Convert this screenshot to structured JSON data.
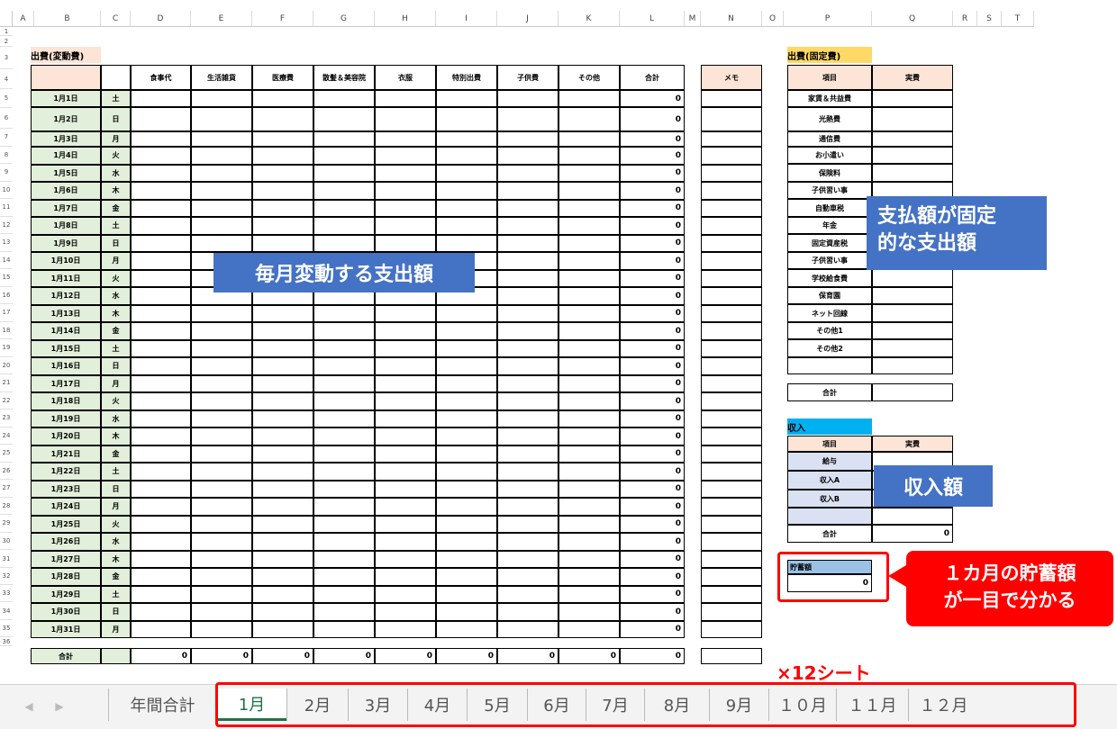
{
  "columns": [
    "A",
    "B",
    "C",
    "D",
    "E",
    "F",
    "G",
    "H",
    "I",
    "J",
    "K",
    "L",
    "M",
    "N",
    "O",
    "P",
    "Q",
    "R",
    "S",
    "T"
  ],
  "rows": [
    "1",
    "2",
    "3",
    "4",
    "5",
    "6",
    "7",
    "8",
    "9",
    "10",
    "11",
    "12",
    "13",
    "14",
    "15",
    "16",
    "17",
    "18",
    "19",
    "20",
    "21",
    "22",
    "23",
    "24",
    "25",
    "26",
    "27",
    "28",
    "29",
    "30",
    "31",
    "32",
    "33",
    "34",
    "35",
    "36"
  ],
  "variable": {
    "title": "出費(変動費)",
    "headers": [
      "食事代",
      "生活雑貨",
      "医療費",
      "散髪＆美容院",
      "衣服",
      "特別出費",
      "子供費",
      "その他",
      "合計"
    ],
    "days": [
      {
        "date": "1月1日",
        "dow": "土"
      },
      {
        "date": "1月2日",
        "dow": "日"
      },
      {
        "date": "1月3日",
        "dow": "月"
      },
      {
        "date": "1月4日",
        "dow": "火"
      },
      {
        "date": "1月5日",
        "dow": "水"
      },
      {
        "date": "1月6日",
        "dow": "木"
      },
      {
        "date": "1月7日",
        "dow": "金"
      },
      {
        "date": "1月8日",
        "dow": "土"
      },
      {
        "date": "1月9日",
        "dow": "日"
      },
      {
        "date": "1月10日",
        "dow": "月"
      },
      {
        "date": "1月11日",
        "dow": "火"
      },
      {
        "date": "1月12日",
        "dow": "水"
      },
      {
        "date": "1月13日",
        "dow": "木"
      },
      {
        "date": "1月14日",
        "dow": "金"
      },
      {
        "date": "1月15日",
        "dow": "土"
      },
      {
        "date": "1月16日",
        "dow": "日"
      },
      {
        "date": "1月17日",
        "dow": "月"
      },
      {
        "date": "1月18日",
        "dow": "火"
      },
      {
        "date": "1月19日",
        "dow": "水"
      },
      {
        "date": "1月20日",
        "dow": "木"
      },
      {
        "date": "1月21日",
        "dow": "金"
      },
      {
        "date": "1月22日",
        "dow": "土"
      },
      {
        "date": "1月23日",
        "dow": "日"
      },
      {
        "date": "1月24日",
        "dow": "月"
      },
      {
        "date": "1月25日",
        "dow": "火"
      },
      {
        "date": "1月26日",
        "dow": "水"
      },
      {
        "date": "1月27日",
        "dow": "木"
      },
      {
        "date": "1月28日",
        "dow": "金"
      },
      {
        "date": "1月29日",
        "dow": "土"
      },
      {
        "date": "1月30日",
        "dow": "日"
      },
      {
        "date": "1月31日",
        "dow": "月"
      }
    ],
    "row_total": "0",
    "total_label": "合計",
    "footer_values": [
      "0",
      "0",
      "0",
      "0",
      "0",
      "0",
      "0",
      "0",
      "0"
    ]
  },
  "memo": {
    "header": "メモ"
  },
  "fixed": {
    "title": "出費(固定費)",
    "header_item": "項目",
    "header_amount": "実費",
    "items": [
      "家賃＆共益費",
      "光熱費",
      "通信費",
      "お小遣い",
      "保険料",
      "子供習い事",
      "自動車税",
      "年金",
      "固定資産税",
      "子供習い事",
      "学校給食費",
      "保育園",
      "ネット回線",
      "その他1",
      "その他2",
      ""
    ],
    "total_label": "合計"
  },
  "income": {
    "title": "収入",
    "header_item": "項目",
    "header_amount": "実費",
    "items": [
      "給与",
      "収入A",
      "収入B",
      ""
    ],
    "total_label": "合計",
    "total_value": "0"
  },
  "savings": {
    "label": "貯蓄額",
    "value": "0"
  },
  "annotations": {
    "variable_callout": "毎月変動する支出額",
    "fixed_callout_line1": "支払額が固定",
    "fixed_callout_line2": "的な支出額",
    "income_callout": "収入額",
    "savings_callout_line1": "１カ月の貯蓄額",
    "savings_callout_line2": "が一目で分かる",
    "sheets_note": "×12シート"
  },
  "tabs": [
    "年間合計",
    "1月",
    "2月",
    "3月",
    "4月",
    "5月",
    "6月",
    "7月",
    "8月",
    "9月",
    "１０月",
    "１１月",
    "１２月"
  ],
  "active_tab": "1月",
  "colors": {
    "accent_green": "#217346",
    "callout_blue": "#4472c4",
    "highlight_red": "#ff0000"
  }
}
